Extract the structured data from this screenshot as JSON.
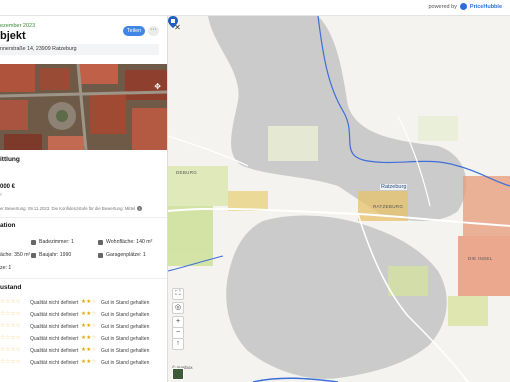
{
  "topbar": {
    "powered_by": "powered by",
    "brand": "PriceHubble"
  },
  "panel": {
    "date_line": "ezember 2023",
    "title": "bjekt",
    "share_label": "Teilen",
    "more_label": "···",
    "address": "nnerstraße 14, 23909 Ratzeburg",
    "valuation": {
      "heading": "ittlung",
      "price": "000 €",
      "price_sub": "²",
      "note": "er Bewertung: 09.11.2023. Die Konfidenzstufe für die Bewertung: Mittel"
    },
    "location": {
      "heading": "ation",
      "features": [
        {
          "icon": "bedroom-icon",
          "label": "Badezimmer: 1"
        },
        {
          "icon": "living-area-icon",
          "label": "Wohnfläche: 140 m²"
        },
        {
          "icon": "plot-icon",
          "label": "äche: 350 m²"
        },
        {
          "icon": "build-year-icon",
          "label": "Baujahr: 1990"
        },
        {
          "icon": "garage-icon",
          "label": "Garagenplätze: 1"
        },
        {
          "icon": "floor-icon",
          "label": "ze: 1"
        }
      ]
    },
    "condition": {
      "heading": "ustand",
      "rows": [
        {
          "left": "Qualität nicht definiert",
          "right": "Gut in Stand gehalten"
        },
        {
          "left": "Qualität nicht definiert",
          "right": "Gut in Stand gehalten"
        },
        {
          "left": "Qualität nicht definiert",
          "right": "Gut in Stand gehalten"
        },
        {
          "left": "Qualität nicht definiert",
          "right": "Gut in Stand gehalten"
        },
        {
          "left": "Qualität nicht definiert",
          "right": "Gut in Stand gehalten"
        },
        {
          "left": "Qualität nicht definiert",
          "right": "Gut in Stand gehalten"
        }
      ]
    }
  },
  "map": {
    "close": "✕",
    "pin_label": "Ratzeburg",
    "places": [
      "DEBURG",
      "RATZEBURG",
      "DIE INSEL"
    ],
    "controls": [
      "⛶",
      "◎",
      "+",
      "−",
      "↑"
    ],
    "attribution": "© mapbox",
    "colors": {
      "lake": "#cbcbcb",
      "land": "#f4f3f0",
      "road": "#ffffff",
      "river": "#3d6fd8",
      "pin": "#1f5fbf"
    }
  }
}
